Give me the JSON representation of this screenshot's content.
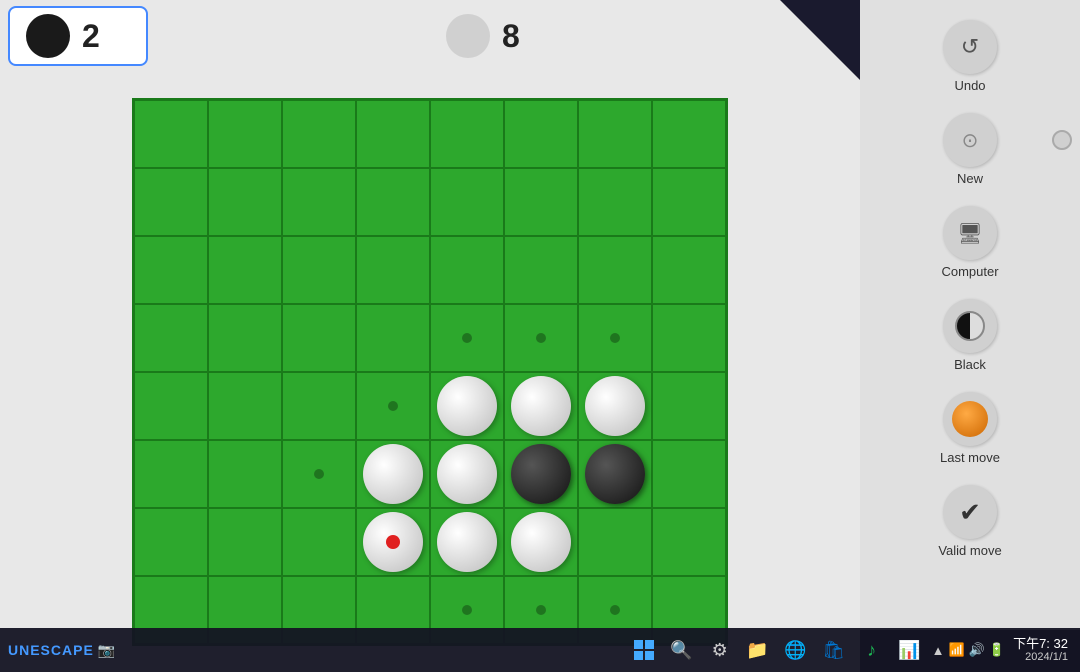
{
  "scores": {
    "black_count": "2",
    "white_count": "8"
  },
  "sidebar": {
    "undo_label": "Undo",
    "new_label": "New",
    "computer_label": "Computer",
    "black_label": "Black",
    "last_move_label": "Last move",
    "valid_move_label": "Valid move"
  },
  "taskbar": {
    "brand": "UNESCAPE",
    "time": "下午7: 32",
    "date": "2024/1/1"
  },
  "board": {
    "cells": [
      [
        null,
        null,
        null,
        null,
        null,
        null,
        null,
        null
      ],
      [
        null,
        null,
        null,
        null,
        null,
        null,
        null,
        null
      ],
      [
        null,
        null,
        null,
        null,
        null,
        null,
        null,
        null
      ],
      [
        null,
        null,
        null,
        null,
        "dot",
        "dot",
        "dot",
        null
      ],
      [
        null,
        null,
        null,
        "dot",
        "white",
        "white",
        "white",
        null
      ],
      [
        null,
        null,
        "dot",
        "white",
        "white",
        "black",
        "black",
        null
      ],
      [
        null,
        null,
        null,
        "white-red",
        "white",
        "white",
        null,
        null
      ],
      [
        null,
        null,
        null,
        null,
        "dot",
        "dot",
        "dot",
        null
      ]
    ]
  }
}
